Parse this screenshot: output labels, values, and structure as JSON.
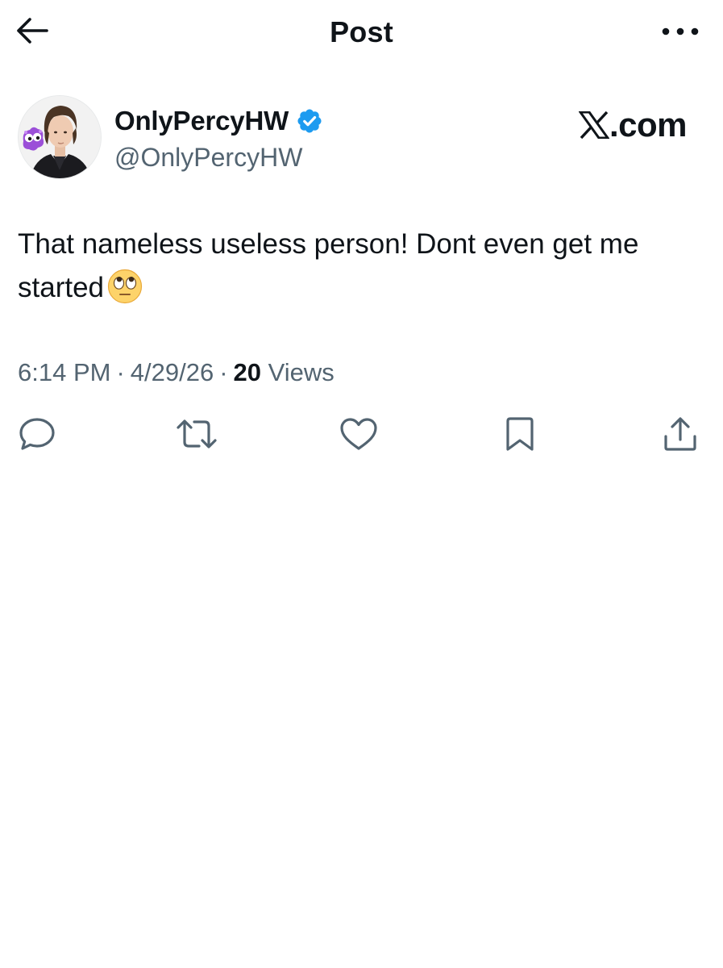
{
  "header": {
    "back_icon": "arrow-left-icon",
    "title": "Post",
    "more_icon": "more-horizontal-icon"
  },
  "author": {
    "display_name": "OnlyPercyHW",
    "handle": "@OnlyPercyHW",
    "verified": true,
    "verified_color": "#1d9bf0"
  },
  "brand": {
    "text": ".com",
    "logo_icon": "x-logo-icon"
  },
  "post": {
    "text": "That nameless useless person! Dont even get me started",
    "emoji": "face-with-rolling-eyes"
  },
  "meta": {
    "time": "6:14 PM",
    "separator": "·",
    "date": "4/29/26",
    "views_count": "20",
    "views_label": "Views"
  },
  "actions": [
    {
      "name": "reply",
      "icon": "reply-icon"
    },
    {
      "name": "repost",
      "icon": "repost-icon"
    },
    {
      "name": "like",
      "icon": "heart-icon"
    },
    {
      "name": "bookmark",
      "icon": "bookmark-icon"
    },
    {
      "name": "share",
      "icon": "share-icon"
    }
  ],
  "colors": {
    "text_primary": "#0f1419",
    "text_secondary": "#536471",
    "background": "#ffffff"
  }
}
